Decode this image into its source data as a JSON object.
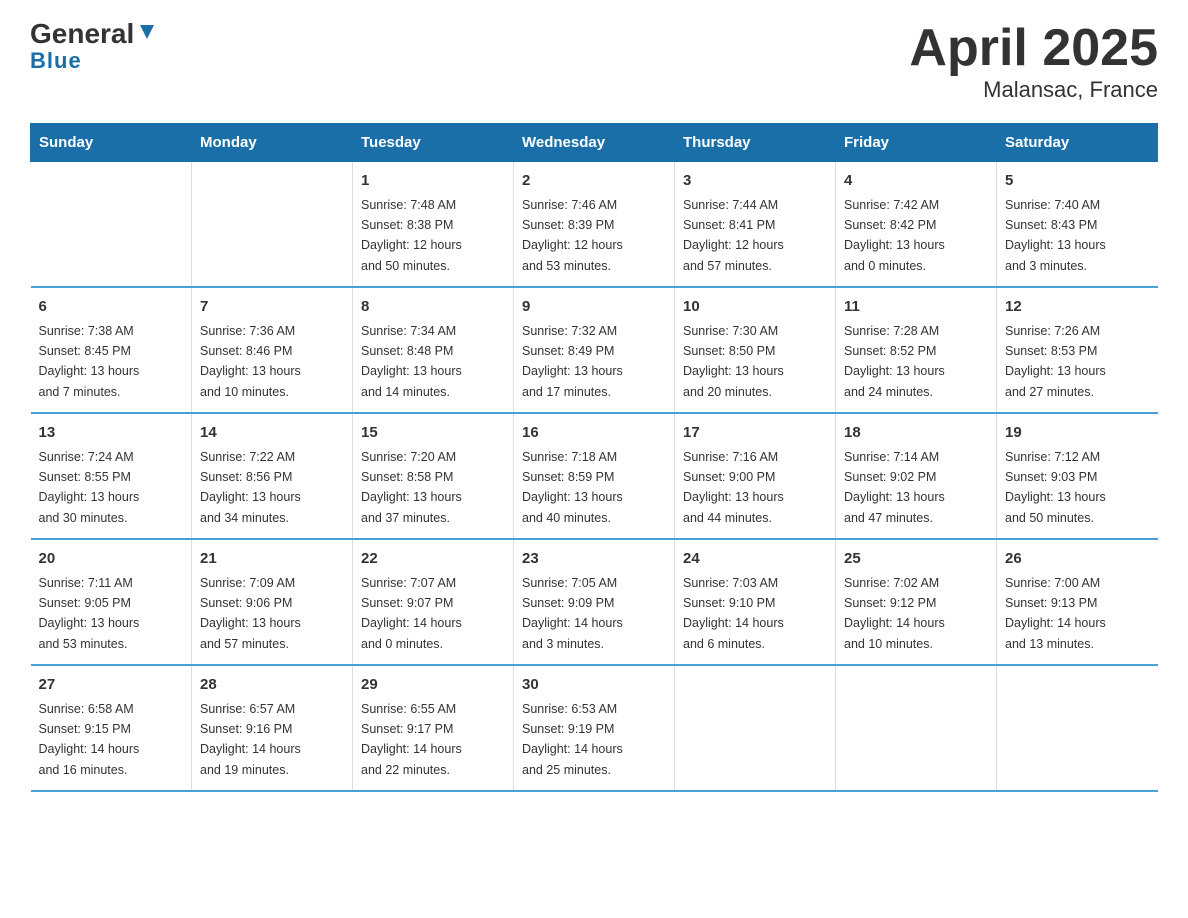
{
  "logo": {
    "general": "General",
    "blue": "Blue"
  },
  "title": "April 2025",
  "subtitle": "Malansac, France",
  "days_of_week": [
    "Sunday",
    "Monday",
    "Tuesday",
    "Wednesday",
    "Thursday",
    "Friday",
    "Saturday"
  ],
  "weeks": [
    [
      null,
      null,
      {
        "day": "1",
        "sunrise": "Sunrise: 7:48 AM",
        "sunset": "Sunset: 8:38 PM",
        "daylight": "Daylight: 12 hours",
        "daylight2": "and 50 minutes."
      },
      {
        "day": "2",
        "sunrise": "Sunrise: 7:46 AM",
        "sunset": "Sunset: 8:39 PM",
        "daylight": "Daylight: 12 hours",
        "daylight2": "and 53 minutes."
      },
      {
        "day": "3",
        "sunrise": "Sunrise: 7:44 AM",
        "sunset": "Sunset: 8:41 PM",
        "daylight": "Daylight: 12 hours",
        "daylight2": "and 57 minutes."
      },
      {
        "day": "4",
        "sunrise": "Sunrise: 7:42 AM",
        "sunset": "Sunset: 8:42 PM",
        "daylight": "Daylight: 13 hours",
        "daylight2": "and 0 minutes."
      },
      {
        "day": "5",
        "sunrise": "Sunrise: 7:40 AM",
        "sunset": "Sunset: 8:43 PM",
        "daylight": "Daylight: 13 hours",
        "daylight2": "and 3 minutes."
      }
    ],
    [
      {
        "day": "6",
        "sunrise": "Sunrise: 7:38 AM",
        "sunset": "Sunset: 8:45 PM",
        "daylight": "Daylight: 13 hours",
        "daylight2": "and 7 minutes."
      },
      {
        "day": "7",
        "sunrise": "Sunrise: 7:36 AM",
        "sunset": "Sunset: 8:46 PM",
        "daylight": "Daylight: 13 hours",
        "daylight2": "and 10 minutes."
      },
      {
        "day": "8",
        "sunrise": "Sunrise: 7:34 AM",
        "sunset": "Sunset: 8:48 PM",
        "daylight": "Daylight: 13 hours",
        "daylight2": "and 14 minutes."
      },
      {
        "day": "9",
        "sunrise": "Sunrise: 7:32 AM",
        "sunset": "Sunset: 8:49 PM",
        "daylight": "Daylight: 13 hours",
        "daylight2": "and 17 minutes."
      },
      {
        "day": "10",
        "sunrise": "Sunrise: 7:30 AM",
        "sunset": "Sunset: 8:50 PM",
        "daylight": "Daylight: 13 hours",
        "daylight2": "and 20 minutes."
      },
      {
        "day": "11",
        "sunrise": "Sunrise: 7:28 AM",
        "sunset": "Sunset: 8:52 PM",
        "daylight": "Daylight: 13 hours",
        "daylight2": "and 24 minutes."
      },
      {
        "day": "12",
        "sunrise": "Sunrise: 7:26 AM",
        "sunset": "Sunset: 8:53 PM",
        "daylight": "Daylight: 13 hours",
        "daylight2": "and 27 minutes."
      }
    ],
    [
      {
        "day": "13",
        "sunrise": "Sunrise: 7:24 AM",
        "sunset": "Sunset: 8:55 PM",
        "daylight": "Daylight: 13 hours",
        "daylight2": "and 30 minutes."
      },
      {
        "day": "14",
        "sunrise": "Sunrise: 7:22 AM",
        "sunset": "Sunset: 8:56 PM",
        "daylight": "Daylight: 13 hours",
        "daylight2": "and 34 minutes."
      },
      {
        "day": "15",
        "sunrise": "Sunrise: 7:20 AM",
        "sunset": "Sunset: 8:58 PM",
        "daylight": "Daylight: 13 hours",
        "daylight2": "and 37 minutes."
      },
      {
        "day": "16",
        "sunrise": "Sunrise: 7:18 AM",
        "sunset": "Sunset: 8:59 PM",
        "daylight": "Daylight: 13 hours",
        "daylight2": "and 40 minutes."
      },
      {
        "day": "17",
        "sunrise": "Sunrise: 7:16 AM",
        "sunset": "Sunset: 9:00 PM",
        "daylight": "Daylight: 13 hours",
        "daylight2": "and 44 minutes."
      },
      {
        "day": "18",
        "sunrise": "Sunrise: 7:14 AM",
        "sunset": "Sunset: 9:02 PM",
        "daylight": "Daylight: 13 hours",
        "daylight2": "and 47 minutes."
      },
      {
        "day": "19",
        "sunrise": "Sunrise: 7:12 AM",
        "sunset": "Sunset: 9:03 PM",
        "daylight": "Daylight: 13 hours",
        "daylight2": "and 50 minutes."
      }
    ],
    [
      {
        "day": "20",
        "sunrise": "Sunrise: 7:11 AM",
        "sunset": "Sunset: 9:05 PM",
        "daylight": "Daylight: 13 hours",
        "daylight2": "and 53 minutes."
      },
      {
        "day": "21",
        "sunrise": "Sunrise: 7:09 AM",
        "sunset": "Sunset: 9:06 PM",
        "daylight": "Daylight: 13 hours",
        "daylight2": "and 57 minutes."
      },
      {
        "day": "22",
        "sunrise": "Sunrise: 7:07 AM",
        "sunset": "Sunset: 9:07 PM",
        "daylight": "Daylight: 14 hours",
        "daylight2": "and 0 minutes."
      },
      {
        "day": "23",
        "sunrise": "Sunrise: 7:05 AM",
        "sunset": "Sunset: 9:09 PM",
        "daylight": "Daylight: 14 hours",
        "daylight2": "and 3 minutes."
      },
      {
        "day": "24",
        "sunrise": "Sunrise: 7:03 AM",
        "sunset": "Sunset: 9:10 PM",
        "daylight": "Daylight: 14 hours",
        "daylight2": "and 6 minutes."
      },
      {
        "day": "25",
        "sunrise": "Sunrise: 7:02 AM",
        "sunset": "Sunset: 9:12 PM",
        "daylight": "Daylight: 14 hours",
        "daylight2": "and 10 minutes."
      },
      {
        "day": "26",
        "sunrise": "Sunrise: 7:00 AM",
        "sunset": "Sunset: 9:13 PM",
        "daylight": "Daylight: 14 hours",
        "daylight2": "and 13 minutes."
      }
    ],
    [
      {
        "day": "27",
        "sunrise": "Sunrise: 6:58 AM",
        "sunset": "Sunset: 9:15 PM",
        "daylight": "Daylight: 14 hours",
        "daylight2": "and 16 minutes."
      },
      {
        "day": "28",
        "sunrise": "Sunrise: 6:57 AM",
        "sunset": "Sunset: 9:16 PM",
        "daylight": "Daylight: 14 hours",
        "daylight2": "and 19 minutes."
      },
      {
        "day": "29",
        "sunrise": "Sunrise: 6:55 AM",
        "sunset": "Sunset: 9:17 PM",
        "daylight": "Daylight: 14 hours",
        "daylight2": "and 22 minutes."
      },
      {
        "day": "30",
        "sunrise": "Sunrise: 6:53 AM",
        "sunset": "Sunset: 9:19 PM",
        "daylight": "Daylight: 14 hours",
        "daylight2": "and 25 minutes."
      },
      null,
      null,
      null
    ]
  ]
}
